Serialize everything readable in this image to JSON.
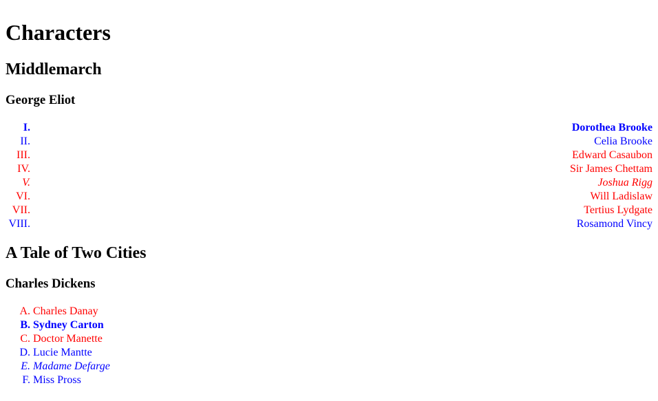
{
  "page": {
    "title": "Characters"
  },
  "colors": {
    "red": "#ff0000",
    "blue": "#0000ff",
    "text": "#000000",
    "background": "#ffffff"
  },
  "books": [
    {
      "title": "Middlemarch",
      "author": "George Eliot",
      "list_type": "upper-roman",
      "align": "right",
      "characters": [
        {
          "marker": "I.",
          "name": "Dorothea Brooke",
          "color": "#0000ff",
          "weight": "bold",
          "style": "normal"
        },
        {
          "marker": "II.",
          "name": "Celia Brooke",
          "color": "#0000ff",
          "weight": "normal",
          "style": "normal"
        },
        {
          "marker": "III.",
          "name": "Edward Casaubon",
          "color": "#ff0000",
          "weight": "normal",
          "style": "normal"
        },
        {
          "marker": "IV.",
          "name": "Sir James Chettam",
          "color": "#ff0000",
          "weight": "normal",
          "style": "normal"
        },
        {
          "marker": "V.",
          "name": "Joshua Rigg",
          "color": "#ff0000",
          "weight": "normal",
          "style": "italic"
        },
        {
          "marker": "VI.",
          "name": "Will Ladislaw",
          "color": "#ff0000",
          "weight": "normal",
          "style": "normal"
        },
        {
          "marker": "VII.",
          "name": "Tertius Lydgate",
          "color": "#ff0000",
          "weight": "normal",
          "style": "normal"
        },
        {
          "marker": "VIII.",
          "name": "Rosamond Vincy",
          "color": "#0000ff",
          "weight": "normal",
          "style": "normal"
        }
      ]
    },
    {
      "title": "A Tale of Two Cities",
      "author": "Charles Dickens",
      "list_type": "upper-alpha",
      "align": "left",
      "characters": [
        {
          "marker": "A.",
          "name": "Charles Danay",
          "color": "#ff0000",
          "weight": "normal",
          "style": "normal"
        },
        {
          "marker": "B.",
          "name": "Sydney Carton",
          "color": "#0000ff",
          "weight": "bold",
          "style": "normal"
        },
        {
          "marker": "C.",
          "name": "Doctor Manette",
          "color": "#ff0000",
          "weight": "normal",
          "style": "normal"
        },
        {
          "marker": "D.",
          "name": "Lucie Mantte",
          "color": "#0000ff",
          "weight": "normal",
          "style": "normal"
        },
        {
          "marker": "E.",
          "name": "Madame Defarge",
          "color": "#0000ff",
          "weight": "normal",
          "style": "italic"
        },
        {
          "marker": "F.",
          "name": "Miss Pross",
          "color": "#0000ff",
          "weight": "normal",
          "style": "normal"
        }
      ]
    }
  ]
}
